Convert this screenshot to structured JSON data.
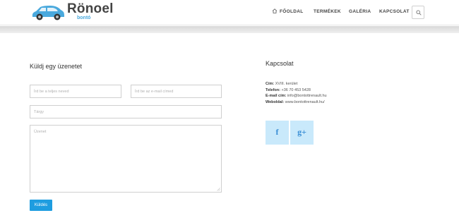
{
  "brand": {
    "name": "Rönoel",
    "subtitle": "bontó",
    "accent": "#1e9de0"
  },
  "nav": {
    "items": [
      "FŐOLDAL",
      "TERMÉKEK",
      "GALÉRIA",
      "KAPCSOLAT"
    ],
    "search_icon": "search-icon"
  },
  "form": {
    "title": "Küldj egy üzenetet",
    "name_placeholder": "Írd be a teljes neved",
    "email_placeholder": "Írd be az e-mail címed",
    "subject_placeholder": "Tárgy",
    "message_placeholder": "Üzenet",
    "send_label": "Küldés"
  },
  "contact": {
    "title": "Kapcsolat",
    "lines": [
      {
        "label": "Cím:",
        "value": "XVIII. kerület"
      },
      {
        "label": "Telefon:",
        "value": "+36 70 453 5428"
      },
      {
        "label": "E-mail cím:",
        "value": "info@bontottrenault.hu"
      },
      {
        "label": "Weboldal:",
        "value": "www.bontottrenault.hu/"
      }
    ],
    "social": [
      "f",
      "g+"
    ]
  }
}
